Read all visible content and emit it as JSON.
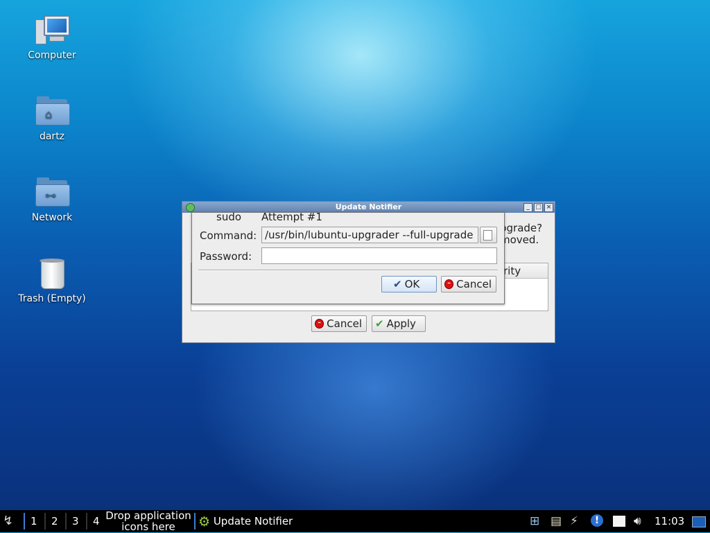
{
  "desktop": {
    "icons": [
      {
        "label": "Computer",
        "icon": "computer-icon"
      },
      {
        "label": "dartz",
        "icon": "home-folder-icon"
      },
      {
        "label": "Network",
        "icon": "network-folder-icon"
      },
      {
        "label": "Trash (Empty)",
        "icon": "trash-icon"
      }
    ]
  },
  "update_window": {
    "title": "Update Notifier",
    "partial_text_1": "pgrade?",
    "partial_text_2": "moved.",
    "partial_col": "rity",
    "cancel_label": "Cancel",
    "apply_label": "Apply"
  },
  "sudo_dialog": {
    "header_left": "sudo",
    "header_right": "Attempt #1",
    "command_label": "Command:",
    "command_value": "/usr/bin/lubuntu-upgrader --full-upgrade",
    "password_label": "Password:",
    "password_value": "",
    "ok_label": "OK",
    "cancel_label": "Cancel"
  },
  "taskbar": {
    "workspaces": [
      "1",
      "2",
      "3",
      "4"
    ],
    "launcher_hint_line1": "Drop application",
    "launcher_hint_line2": "icons here",
    "task_label": "Update Notifier",
    "clock": "11:03"
  }
}
